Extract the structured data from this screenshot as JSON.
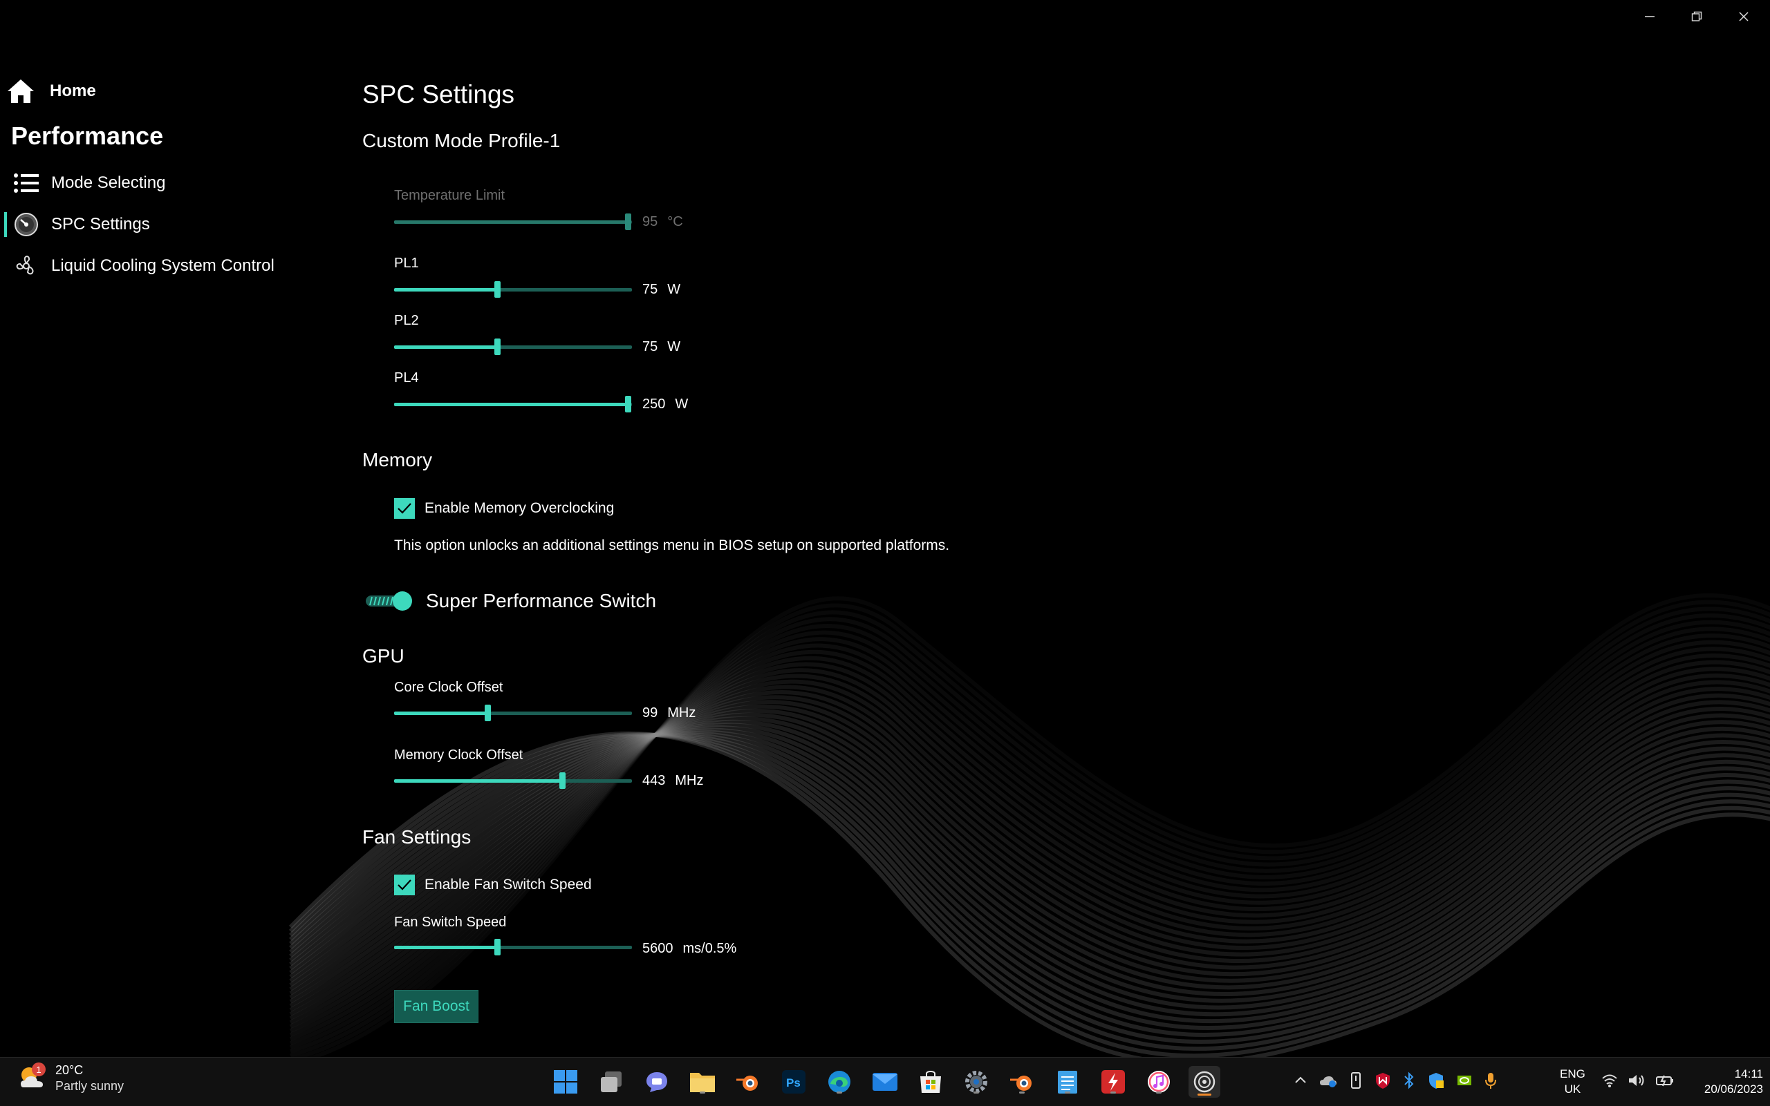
{
  "window": {
    "minimize_icon": "minimize-icon",
    "restore_icon": "restore-icon",
    "close_icon": "close-icon"
  },
  "sidebar": {
    "home_label": "Home",
    "section_title": "Performance",
    "items": [
      {
        "label": "Mode Selecting",
        "icon": "list-icon"
      },
      {
        "label": "SPC Settings",
        "icon": "gauge-icon",
        "active": true
      },
      {
        "label": "Liquid Cooling System Control",
        "icon": "fan-icon"
      }
    ]
  },
  "main": {
    "title": "SPC Settings",
    "profile": "Custom Mode Profile-1",
    "power": {
      "temperature_limit": {
        "label": "Temperature Limit",
        "value": "95",
        "unit": "°C",
        "fraction": 1.0,
        "disabled": true
      },
      "pl1": {
        "label": "PL1",
        "value": "75",
        "unit": "W",
        "fraction": 0.44
      },
      "pl2": {
        "label": "PL2",
        "value": "75",
        "unit": "W",
        "fraction": 0.44
      },
      "pl4": {
        "label": "PL4",
        "value": "250",
        "unit": "W",
        "fraction": 1.0
      }
    },
    "memory": {
      "heading": "Memory",
      "checkbox_label": "Enable Memory Overclocking",
      "checked": true,
      "description": "This option unlocks an additional settings menu in BIOS setup on supported platforms."
    },
    "super_switch": {
      "label": "Super Performance Switch",
      "on": true
    },
    "gpu": {
      "heading": "GPU",
      "core_clock": {
        "label": "Core Clock Offset",
        "value": "99",
        "unit": "MHz",
        "fraction": 0.4
      },
      "memory_clock": {
        "label": "Memory Clock Offset",
        "value": "443",
        "unit": "MHz",
        "fraction": 0.72
      }
    },
    "fan": {
      "heading": "Fan Settings",
      "checkbox_label": "Enable Fan Switch Speed",
      "checked": true,
      "speed": {
        "label": "Fan Switch Speed",
        "value": "5600",
        "unit": "ms/0.5%",
        "fraction": 0.44
      },
      "boost_label": "Fan Boost"
    }
  },
  "taskbar": {
    "weather_temp": "20°C",
    "weather_desc": "Partly sunny",
    "weather_badge": "1",
    "apps": [
      "start-icon",
      "task-view-icon",
      "chat-icon",
      "file-explorer-icon",
      "blender-icon",
      "photoshop-icon",
      "edge-icon",
      "mail-icon",
      "store-icon",
      "settings-icon",
      "blender-2-icon",
      "notepad-icon",
      "flash-icon",
      "itunes-icon",
      "control-center-icon"
    ],
    "lang_top": "ENG",
    "lang_bottom": "UK",
    "time": "14:11",
    "date": "20/06/2023"
  },
  "colors": {
    "accent": "#3dd9bd",
    "accent_dark": "#1c5f55",
    "background": "#000000"
  }
}
